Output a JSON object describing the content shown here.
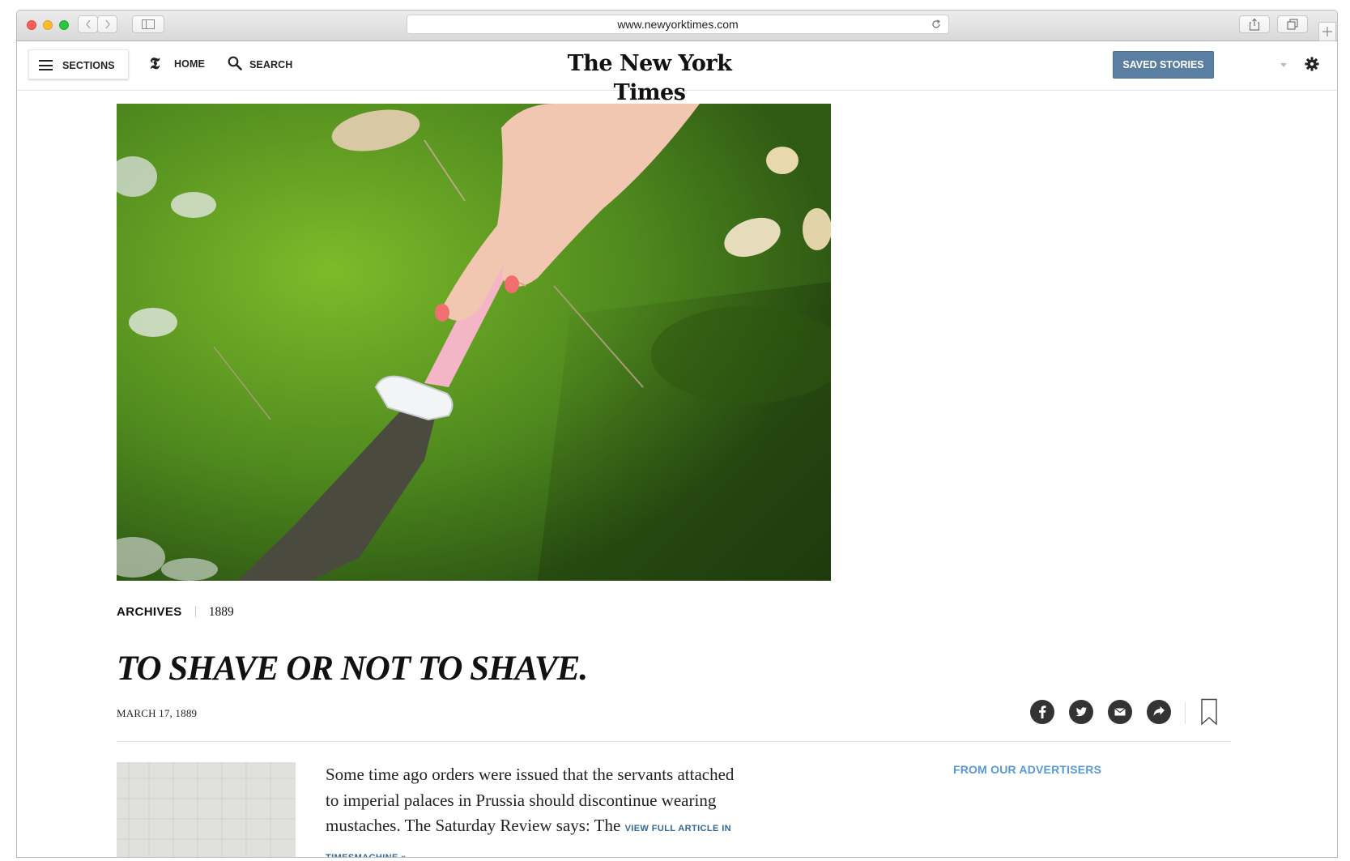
{
  "browser": {
    "url": "www.newyorktimes.com"
  },
  "header": {
    "sections_label": "SECTIONS",
    "home_label": "HOME",
    "search_label": "SEARCH",
    "logo_text": "The New York Times",
    "saved_label": "SAVED STORIES"
  },
  "article": {
    "kicker": "ARCHIVES",
    "year": "1889",
    "headline": "TO SHAVE OR NOT TO SHAVE.",
    "date": "MARCH 17, 1889",
    "body": "Some time ago orders were issued that the servants attached to imperial palaces in Prussia should discontinue wearing mustaches. The Saturday Review says: The",
    "timesmachine_link": "VIEW FULL ARTICLE IN TIMESMACHINE »"
  },
  "sidebar": {
    "advertisers_label": "FROM OUR ADVERTISERS"
  },
  "share": {
    "items": [
      "facebook-icon",
      "twitter-icon",
      "email-icon",
      "share-icon",
      "bookmark-icon"
    ]
  },
  "colors": {
    "saved_button": "#5a7fa3",
    "advertisers_link": "#5699d6",
    "moss": "#4f8a1e"
  }
}
